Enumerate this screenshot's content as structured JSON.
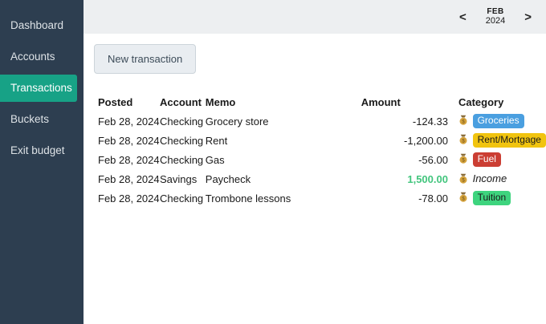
{
  "sidebar": {
    "items": [
      {
        "label": "Dashboard",
        "active": false
      },
      {
        "label": "Accounts",
        "active": false
      },
      {
        "label": "Transactions",
        "active": true
      },
      {
        "label": "Buckets",
        "active": false
      },
      {
        "label": "Exit budget",
        "active": false
      }
    ]
  },
  "topbar": {
    "prev_icon": "<",
    "next_icon": ">",
    "month": "FEB",
    "year": "2024"
  },
  "toolbar": {
    "new_transaction_label": "New transaction"
  },
  "table": {
    "columns": [
      "Posted",
      "Account",
      "Memo",
      "Amount",
      "Category"
    ],
    "rows": [
      {
        "posted": "Feb 28, 2024",
        "account": "Checking",
        "memo": "Grocery store",
        "amount": "-124.33",
        "amount_positive": false,
        "category": {
          "label": "Groceries",
          "bg": "#4a9fe0",
          "text": "#ffffff"
        }
      },
      {
        "posted": "Feb 28, 2024",
        "account": "Checking",
        "memo": "Rent",
        "amount": "-1,200.00",
        "amount_positive": false,
        "category": {
          "label": "Rent/Mortgage",
          "bg": "#f1c40f",
          "text": "#1a1a1a"
        }
      },
      {
        "posted": "Feb 28, 2024",
        "account": "Checking",
        "memo": "Gas",
        "amount": "-56.00",
        "amount_positive": false,
        "category": {
          "label": "Fuel",
          "bg": "#cb3e33",
          "text": "#ffffff"
        }
      },
      {
        "posted": "Feb 28, 2024",
        "account": "Savings",
        "memo": "Paycheck",
        "amount": "1,500.00",
        "amount_positive": true,
        "category": {
          "label": "Income",
          "bg": null,
          "text": null,
          "icon": "money-bag"
        }
      },
      {
        "posted": "Feb 28, 2024",
        "account": "Checking",
        "memo": "Trombone lessons",
        "amount": "-78.00",
        "amount_positive": false,
        "category": {
          "label": "Tuition",
          "bg": "#3ed47e",
          "text": "#1a1a1a"
        }
      }
    ]
  },
  "colors": {
    "sidebar_bg": "#2d3e50",
    "active_item_bg": "#17a286",
    "topbar_bg": "#edeff1",
    "positive_amount": "#42c57d"
  }
}
